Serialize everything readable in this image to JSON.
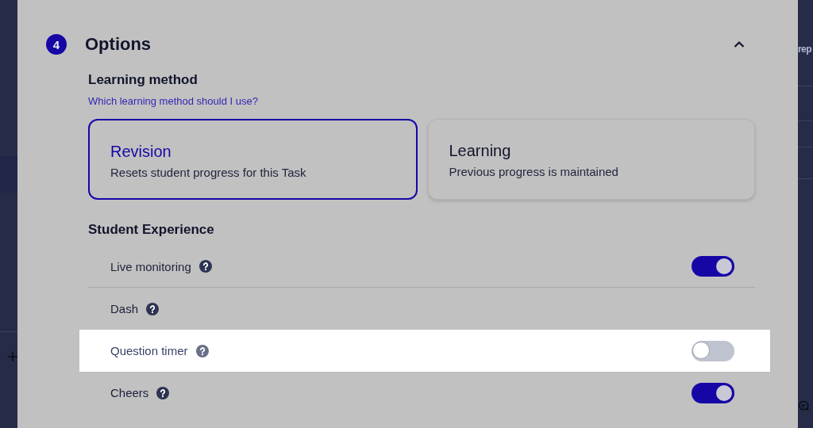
{
  "header": {
    "step": "4",
    "title": "Options",
    "expanded": true
  },
  "learning_method": {
    "title": "Learning method",
    "help_link": "Which learning method should I use?",
    "options": [
      {
        "title": "Revision",
        "description": "Resets student progress for this Task",
        "selected": true
      },
      {
        "title": "Learning",
        "description": "Previous progress is maintained",
        "selected": false
      }
    ]
  },
  "student_experience": {
    "title": "Student Experience",
    "settings": [
      {
        "label": "Live monitoring",
        "kind": "toggle",
        "on": true,
        "highlighted": false,
        "divider": true
      },
      {
        "label": "Dash",
        "kind": "plain",
        "highlighted": false,
        "divider": false
      },
      {
        "label": "Question timer",
        "kind": "toggle",
        "on": false,
        "highlighted": true,
        "divider": false
      },
      {
        "label": "Cheers",
        "kind": "toggle",
        "on": true,
        "highlighted": false,
        "divider": false
      }
    ]
  },
  "background": {
    "right_text": "rep"
  }
}
